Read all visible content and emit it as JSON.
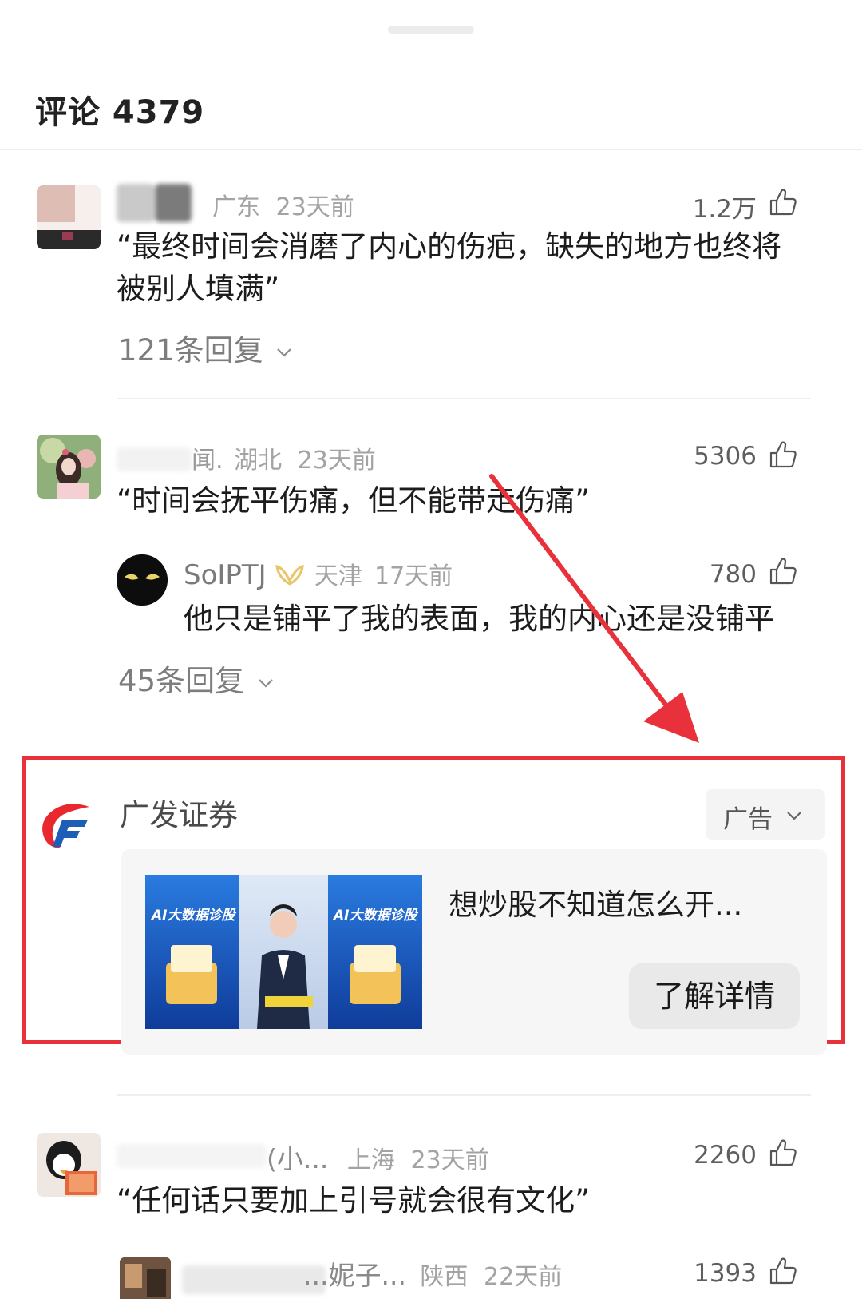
{
  "header": {
    "title": "评论 4379"
  },
  "comments": [
    {
      "region": "广东",
      "time": "23天前",
      "likes": "1.2万",
      "text": "“最终时间会消磨了内心的伤疤，缺失的地方也终将被别人填满”",
      "replies_label": "121条回复"
    },
    {
      "name_fragment": "闻.",
      "region": "湖北",
      "time": "23天前",
      "likes": "5306",
      "text": "“时间会抚平伤痛，但不能带走伤痛”",
      "reply": {
        "name": "SoIPTJ",
        "region": "天津",
        "time": "17天前",
        "likes": "780",
        "text": "他只是铺平了我的表面，我的内心还是没铺平"
      },
      "replies_label": "45条回复"
    },
    {
      "name_fragment": "(小...",
      "region": "上海",
      "time": "23天前",
      "likes": "2260",
      "text": "“任何话只要加上引号就会很有文化”"
    },
    {
      "name_fragment": "...妮子...",
      "region": "陕西",
      "time": "22天前",
      "likes": "1393"
    }
  ],
  "ad": {
    "advertiser": "广发证券",
    "tag_label": "广告",
    "headline": "想炒股不知道怎么开...",
    "cta_label": "了解详情",
    "image_caption_left": "AI大数据诊股",
    "image_caption_right": "AI大数据诊股"
  },
  "icons": {
    "like": "thumbs-up-icon",
    "expand": "chevron-down-icon",
    "badge": "vip-badge-icon"
  },
  "colors": {
    "highlight_border": "#e9313b",
    "arrow": "#e9313b",
    "text_primary": "#1c1c1c",
    "text_secondary": "#a3a3a3"
  }
}
